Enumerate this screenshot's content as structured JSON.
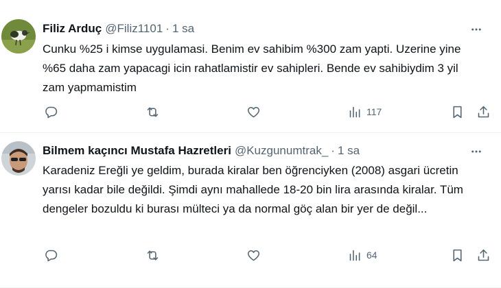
{
  "tweets": [
    {
      "author_name": "Filiz Arduç",
      "handle": "@Filiz1101",
      "separator": "·",
      "time": "1 sa",
      "text": "Cunku %25 i kimse uygulamasi. Benim ev sahibim %300 zam yapti. Uzerine yine %65 daha zam yapacagi icin rahatlamistir ev sahipleri. Bende ev sahibiydim 3 yil zam yapmamistim",
      "views": "117"
    },
    {
      "author_name": "Bilmem kaçıncı Mustafa Hazretleri",
      "handle": "@Kuzgunumtrak_",
      "separator": "·",
      "time": "1 sa",
      "text": "Karadeniz Ereğli ye geldim, burada kiralar ben öğrenciyken (2008) asgari ücretin yarısı kadar bile değildi. Şimdi aynı mahallede 18-20 bin lira arasında kiralar. Tüm dengeler bozuldu ki burası mülteci ya da normal göç alan bir yer de değil...",
      "views": "64"
    }
  ],
  "icons": {
    "reply": "reply-icon",
    "retweet": "retweet-icon",
    "like": "like-icon",
    "views": "views-icon",
    "bookmark": "bookmark-icon",
    "share": "share-icon",
    "more": "more-icon"
  },
  "colors": {
    "text": "#0f1419",
    "secondary": "#536471",
    "divider": "#eff3f4"
  }
}
